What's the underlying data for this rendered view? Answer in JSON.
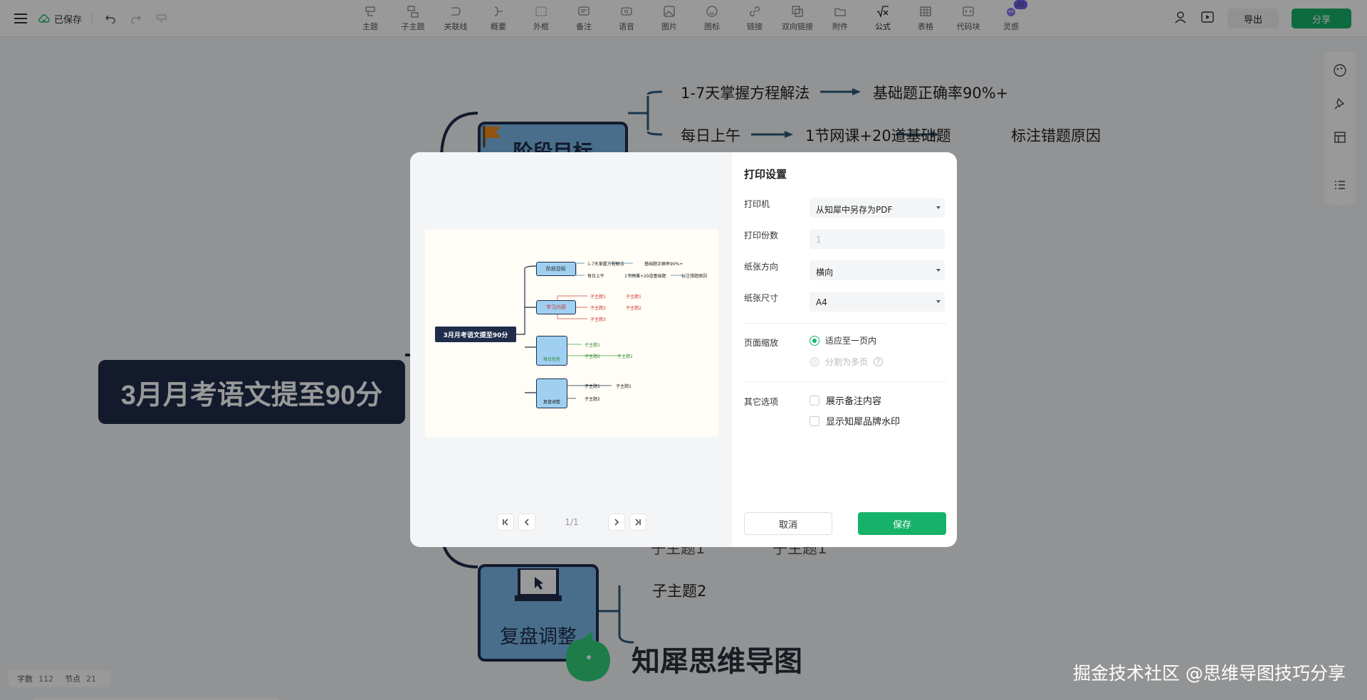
{
  "topbar": {
    "saved_label": "已保存",
    "tools": [
      {
        "icon": "topic-icon",
        "label": "主题"
      },
      {
        "icon": "subtopic-icon",
        "label": "子主题"
      },
      {
        "icon": "relation-line-icon",
        "label": "关联线"
      },
      {
        "icon": "summary-icon",
        "label": "概要"
      },
      {
        "icon": "boundary-icon",
        "label": "外框"
      },
      {
        "icon": "note-icon",
        "label": "备注"
      },
      {
        "icon": "audio-icon",
        "label": "语音"
      },
      {
        "icon": "image-icon",
        "label": "图片"
      },
      {
        "icon": "emoji-icon",
        "label": "图标"
      },
      {
        "icon": "link-icon",
        "label": "链接"
      },
      {
        "icon": "bidirectional-link-icon",
        "label": "双向链接"
      },
      {
        "icon": "attachment-icon",
        "label": "附件"
      },
      {
        "icon": "formula-icon",
        "label": "公式"
      },
      {
        "icon": "table-icon",
        "label": "表格"
      },
      {
        "icon": "code-block-icon",
        "label": "代码块"
      },
      {
        "icon": "inspiration-icon",
        "label": "灵感"
      }
    ],
    "ai_badge": "AI",
    "export_label": "导出",
    "share_label": "分享"
  },
  "mindmap": {
    "root": "3月月考语文提至90分",
    "goal_node": "阶段目标",
    "goal_row1": [
      "1-7天掌握方程解法",
      "基础题正确率90%+"
    ],
    "goal_row2": [
      "每日上午",
      "1节网课+20道基础题",
      "标注错题原因"
    ],
    "review_node": "复盘调整",
    "review_children": [
      "子主题1",
      "子主题1",
      "子主题2"
    ]
  },
  "print_dialog": {
    "title": "打印设置",
    "printer_label": "打印机",
    "printer_value": "从知犀中另存为PDF",
    "copies_label": "打印份数",
    "copies_value": "1",
    "orientation_label": "纸张方向",
    "orientation_value": "横向",
    "size_label": "纸张尺寸",
    "size_value": "A4",
    "scale_label": "页面缩放",
    "scale_fit": "适应至一页内",
    "scale_split": "分割为多页",
    "other_label": "其它选项",
    "show_notes": "展示备注内容",
    "show_watermark": "显示知犀品牌水印",
    "cancel": "取消",
    "save": "保存",
    "page_indicator": "1/1",
    "preview": {
      "root": "3月月考语文提至90分",
      "b1": "阶段目标",
      "b1_r1": [
        "1-7天掌握方程解法",
        "基础题正确率90%+"
      ],
      "b1_r2": [
        "每日上午",
        "1节网课+20道基础题",
        "标注错题原因"
      ],
      "b2": "学习内容",
      "b2_items": [
        "子主题1",
        "子主题1",
        "子主题2",
        "子主题2",
        "子主题3"
      ],
      "b3": "每日任务",
      "b3_items": [
        "子主题1",
        "子主题2",
        "子主题1"
      ],
      "b4": "复盘调整",
      "b4_items": [
        "子主题1",
        "子主题1",
        "子主题2"
      ]
    }
  },
  "status": {
    "words_label": "字数",
    "words": "112",
    "nodes_label": "节点",
    "nodes": "21"
  },
  "brand": {
    "name": "知犀思维导图"
  },
  "watermark": "掘金技术社区 @思维导图技巧分享",
  "colors": {
    "accent": "#17b26a",
    "root": "#1f2c4a",
    "node": "#7bb8e8"
  }
}
